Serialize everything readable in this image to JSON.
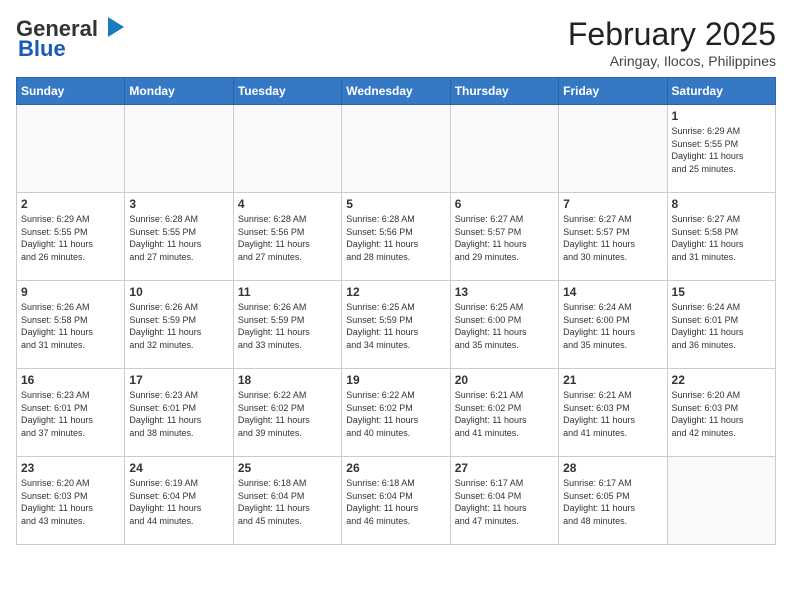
{
  "header": {
    "logo_general": "General",
    "logo_blue": "Blue",
    "month_year": "February 2025",
    "location": "Aringay, Ilocos, Philippines"
  },
  "days_of_week": [
    "Sunday",
    "Monday",
    "Tuesday",
    "Wednesday",
    "Thursday",
    "Friday",
    "Saturday"
  ],
  "weeks": [
    [
      {
        "day": "",
        "info": ""
      },
      {
        "day": "",
        "info": ""
      },
      {
        "day": "",
        "info": ""
      },
      {
        "day": "",
        "info": ""
      },
      {
        "day": "",
        "info": ""
      },
      {
        "day": "",
        "info": ""
      },
      {
        "day": "1",
        "info": "Sunrise: 6:29 AM\nSunset: 5:55 PM\nDaylight: 11 hours\nand 25 minutes."
      }
    ],
    [
      {
        "day": "2",
        "info": "Sunrise: 6:29 AM\nSunset: 5:55 PM\nDaylight: 11 hours\nand 26 minutes."
      },
      {
        "day": "3",
        "info": "Sunrise: 6:28 AM\nSunset: 5:55 PM\nDaylight: 11 hours\nand 27 minutes."
      },
      {
        "day": "4",
        "info": "Sunrise: 6:28 AM\nSunset: 5:56 PM\nDaylight: 11 hours\nand 27 minutes."
      },
      {
        "day": "5",
        "info": "Sunrise: 6:28 AM\nSunset: 5:56 PM\nDaylight: 11 hours\nand 28 minutes."
      },
      {
        "day": "6",
        "info": "Sunrise: 6:27 AM\nSunset: 5:57 PM\nDaylight: 11 hours\nand 29 minutes."
      },
      {
        "day": "7",
        "info": "Sunrise: 6:27 AM\nSunset: 5:57 PM\nDaylight: 11 hours\nand 30 minutes."
      },
      {
        "day": "8",
        "info": "Sunrise: 6:27 AM\nSunset: 5:58 PM\nDaylight: 11 hours\nand 31 minutes."
      }
    ],
    [
      {
        "day": "9",
        "info": "Sunrise: 6:26 AM\nSunset: 5:58 PM\nDaylight: 11 hours\nand 31 minutes."
      },
      {
        "day": "10",
        "info": "Sunrise: 6:26 AM\nSunset: 5:59 PM\nDaylight: 11 hours\nand 32 minutes."
      },
      {
        "day": "11",
        "info": "Sunrise: 6:26 AM\nSunset: 5:59 PM\nDaylight: 11 hours\nand 33 minutes."
      },
      {
        "day": "12",
        "info": "Sunrise: 6:25 AM\nSunset: 5:59 PM\nDaylight: 11 hours\nand 34 minutes."
      },
      {
        "day": "13",
        "info": "Sunrise: 6:25 AM\nSunset: 6:00 PM\nDaylight: 11 hours\nand 35 minutes."
      },
      {
        "day": "14",
        "info": "Sunrise: 6:24 AM\nSunset: 6:00 PM\nDaylight: 11 hours\nand 35 minutes."
      },
      {
        "day": "15",
        "info": "Sunrise: 6:24 AM\nSunset: 6:01 PM\nDaylight: 11 hours\nand 36 minutes."
      }
    ],
    [
      {
        "day": "16",
        "info": "Sunrise: 6:23 AM\nSunset: 6:01 PM\nDaylight: 11 hours\nand 37 minutes."
      },
      {
        "day": "17",
        "info": "Sunrise: 6:23 AM\nSunset: 6:01 PM\nDaylight: 11 hours\nand 38 minutes."
      },
      {
        "day": "18",
        "info": "Sunrise: 6:22 AM\nSunset: 6:02 PM\nDaylight: 11 hours\nand 39 minutes."
      },
      {
        "day": "19",
        "info": "Sunrise: 6:22 AM\nSunset: 6:02 PM\nDaylight: 11 hours\nand 40 minutes."
      },
      {
        "day": "20",
        "info": "Sunrise: 6:21 AM\nSunset: 6:02 PM\nDaylight: 11 hours\nand 41 minutes."
      },
      {
        "day": "21",
        "info": "Sunrise: 6:21 AM\nSunset: 6:03 PM\nDaylight: 11 hours\nand 41 minutes."
      },
      {
        "day": "22",
        "info": "Sunrise: 6:20 AM\nSunset: 6:03 PM\nDaylight: 11 hours\nand 42 minutes."
      }
    ],
    [
      {
        "day": "23",
        "info": "Sunrise: 6:20 AM\nSunset: 6:03 PM\nDaylight: 11 hours\nand 43 minutes."
      },
      {
        "day": "24",
        "info": "Sunrise: 6:19 AM\nSunset: 6:04 PM\nDaylight: 11 hours\nand 44 minutes."
      },
      {
        "day": "25",
        "info": "Sunrise: 6:18 AM\nSunset: 6:04 PM\nDaylight: 11 hours\nand 45 minutes."
      },
      {
        "day": "26",
        "info": "Sunrise: 6:18 AM\nSunset: 6:04 PM\nDaylight: 11 hours\nand 46 minutes."
      },
      {
        "day": "27",
        "info": "Sunrise: 6:17 AM\nSunset: 6:04 PM\nDaylight: 11 hours\nand 47 minutes."
      },
      {
        "day": "28",
        "info": "Sunrise: 6:17 AM\nSunset: 6:05 PM\nDaylight: 11 hours\nand 48 minutes."
      },
      {
        "day": "",
        "info": ""
      }
    ]
  ]
}
